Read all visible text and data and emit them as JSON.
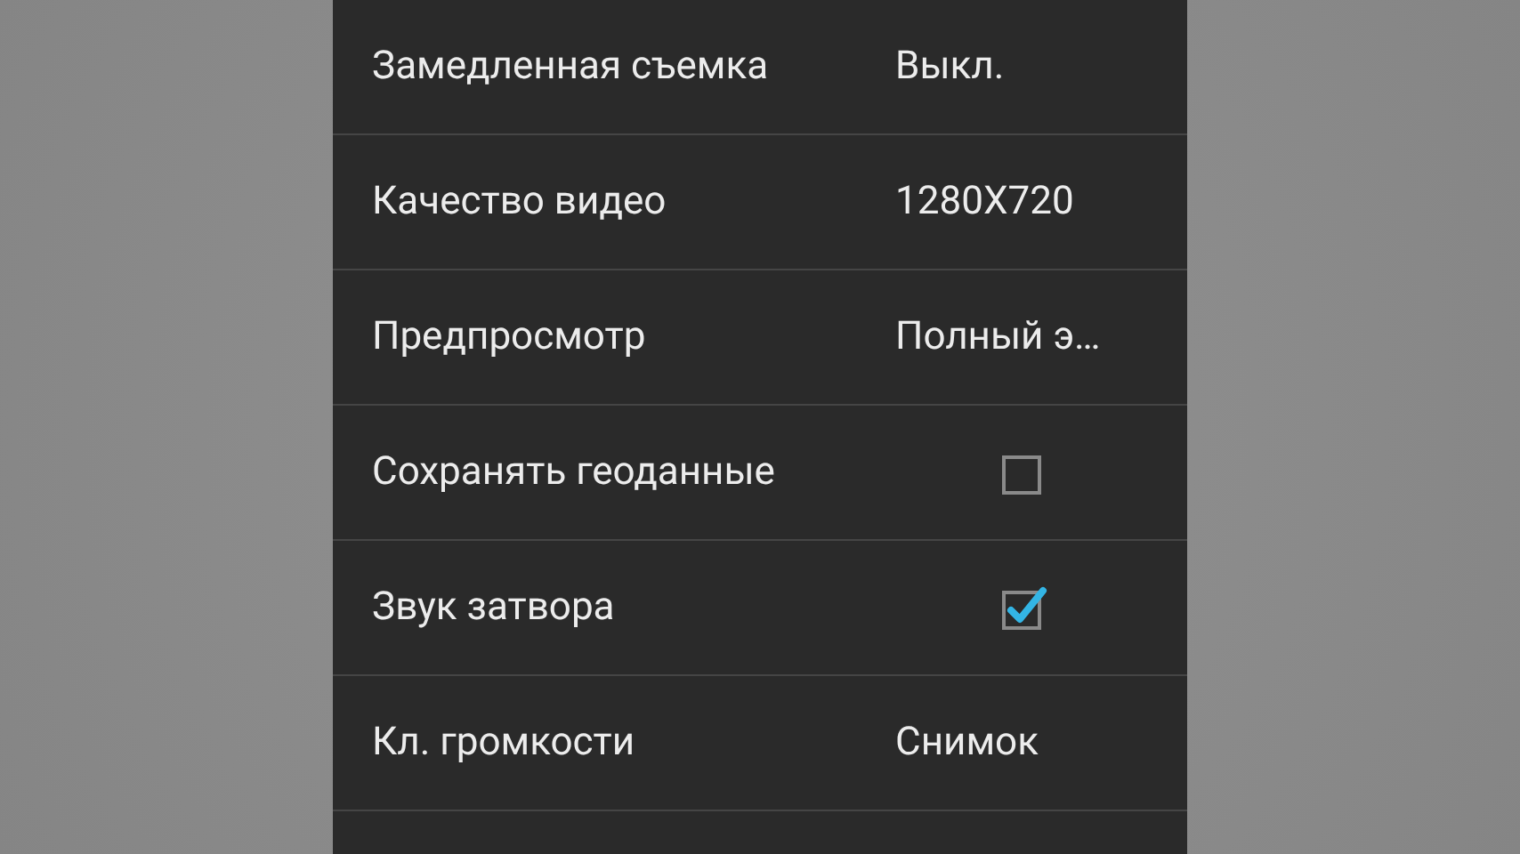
{
  "settings": [
    {
      "kind": "value",
      "label": "Замедленная съемка",
      "value": "Выкл."
    },
    {
      "kind": "value",
      "label": "Качество видео",
      "value": "1280X720"
    },
    {
      "kind": "value",
      "label": "Предпросмотр",
      "value": "Полный э…"
    },
    {
      "kind": "checkbox",
      "label": "Сохранять геоданные",
      "checked": false
    },
    {
      "kind": "checkbox",
      "label": "Звук затвора",
      "checked": true
    },
    {
      "kind": "value",
      "label": "Кл. громкости",
      "value": "Снимок"
    }
  ]
}
